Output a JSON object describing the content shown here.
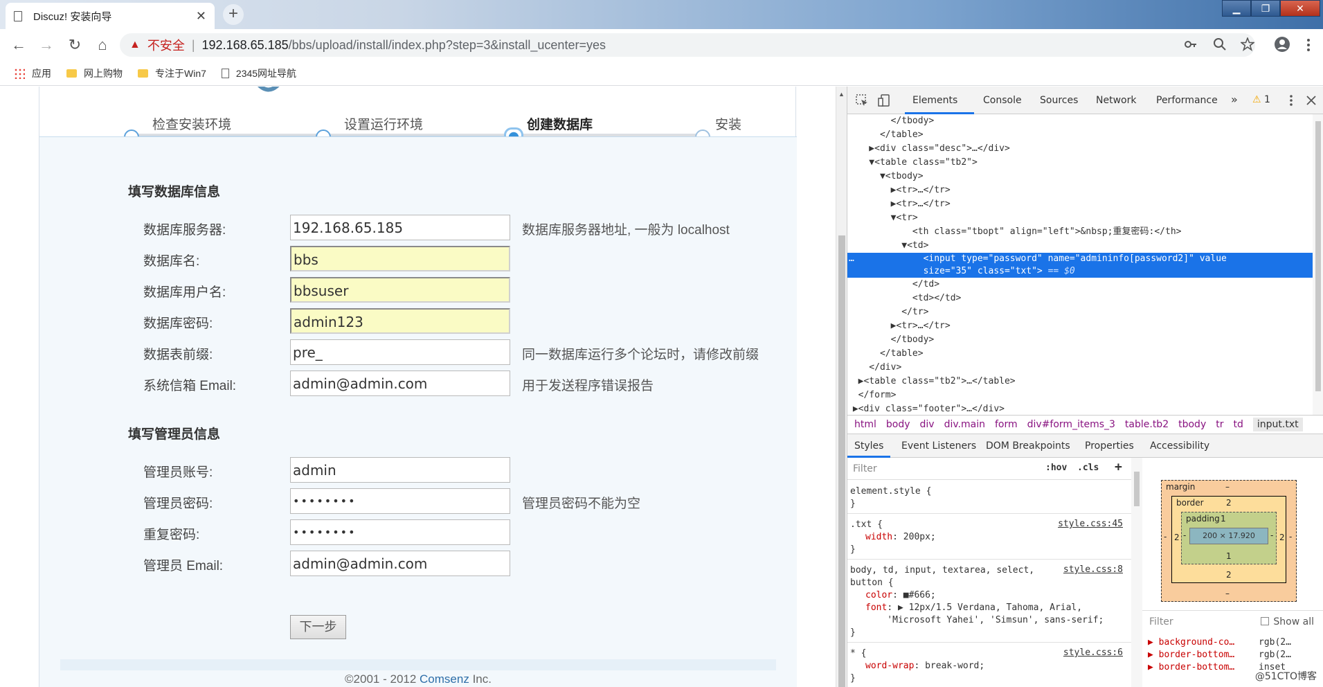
{
  "browser": {
    "tab_title": "Discuz! 安装向导",
    "tab_close": "✕",
    "new_tab": "+",
    "window_controls": [
      "▁",
      "❐",
      "✕"
    ],
    "nav": {
      "back": "←",
      "forward": "→",
      "reload": "↻",
      "home": "⌂"
    },
    "security_icon": "▲",
    "security_label": "不安全",
    "separator": "|",
    "url_host": "192.168.65.185",
    "url_path": "/bbs/upload/install/index.php?step=3&install_ucenter=yes",
    "omni_icons": [
      "key-icon",
      "zoom-icon",
      "star-icon",
      "profile-icon",
      "menu-icon"
    ],
    "bookmarks": [
      {
        "label": "应用",
        "icon": "apps-icon"
      },
      {
        "label": "网上购物",
        "icon": "folder-icon"
      },
      {
        "label": "专注于Win7",
        "icon": "folder-icon"
      },
      {
        "label": "2345网址导航",
        "icon": "page-icon"
      }
    ]
  },
  "installer": {
    "steps": [
      {
        "label": "检查安装环境",
        "state": "done"
      },
      {
        "label": "设置运行环境",
        "state": "done"
      },
      {
        "label": "创建数据库",
        "state": "active"
      },
      {
        "label": "安装",
        "state": "pending"
      }
    ],
    "db_section_title": "填写数据库信息",
    "db_fields": [
      {
        "label": "数据库服务器:",
        "value": "192.168.65.185",
        "hint": "数据库服务器地址, 一般为 localhost",
        "autofill": false
      },
      {
        "label": "数据库名:",
        "value": "bbs",
        "hint": "",
        "autofill": true
      },
      {
        "label": "数据库用户名:",
        "value": "bbsuser",
        "hint": "",
        "autofill": true
      },
      {
        "label": "数据库密码:",
        "value": "admin123",
        "hint": "",
        "autofill": true
      },
      {
        "label": "数据表前缀:",
        "value": "pre_",
        "hint": "同一数据库运行多个论坛时，请修改前缀",
        "autofill": false
      },
      {
        "label": "系统信箱 Email:",
        "value": "admin@admin.com",
        "hint": "用于发送程序错误报告",
        "autofill": false
      }
    ],
    "admin_section_title": "填写管理员信息",
    "admin_fields": [
      {
        "label": "管理员账号:",
        "value": "admin",
        "hint": ""
      },
      {
        "label": "管理员密码:",
        "value": "••••••••",
        "hint": "管理员密码不能为空"
      },
      {
        "label": "重复密码:",
        "value": "••••••••",
        "hint": ""
      },
      {
        "label": "管理员 Email:",
        "value": "admin@admin.com",
        "hint": ""
      }
    ],
    "next_button": "下一步",
    "copyright_prefix": "©2001 - 2012 ",
    "copyright_brand": "Comsenz",
    "copyright_suffix": " Inc."
  },
  "devtools": {
    "tabs": [
      "Elements",
      "Console",
      "Sources",
      "Network",
      "Performance"
    ],
    "more": "»",
    "warning_count": "1",
    "warning_icon": "⚠",
    "dom_lines": [
      "        </tbody>",
      "      </table>",
      "    ▶<div class=\"desc\">…</div>",
      "    ▼<table class=\"tb2\">",
      "      ▼<tbody>",
      "        ▶<tr>…</tr>",
      "        ▶<tr>…</tr>",
      "        ▼<tr>",
      "            <th class=\"tbopt\" align=\"left\">&nbsp;重复密码:</th>",
      "          ▼<td>",
      "",
      "            </td>",
      "            <td></td>",
      "          </tr>",
      "        ▶<tr>…</tr>",
      "        </tbody>",
      "      </table>",
      "    </div>",
      "  ▶<table class=\"tb2\">…</table>",
      "  </form>",
      " ▶<div class=\"footer\">…</div>"
    ],
    "selected_line_1": "              <input type=\"password\" name=\"admininfo[password2]\" value",
    "selected_line_2": "              size=\"35\" class=\"txt\">",
    "selected_eq": " == $0",
    "selected_dots": "…",
    "breadcrumbs": [
      "html",
      "body",
      "div",
      "div.main",
      "form",
      "div#form_items_3",
      "table.tb2",
      "tbody",
      "tr",
      "td",
      "input.txt"
    ],
    "sub_tabs": [
      "Styles",
      "Event Listeners",
      "DOM Breakpoints",
      "Properties",
      "Accessibility"
    ],
    "filter_placeholder": "Filter",
    "hov": ":hov",
    "cls": ".cls",
    "plus": "+",
    "style_rules": [
      {
        "selector": "element.style {",
        "props": [],
        "close": "}",
        "src": ""
      },
      {
        "selector": ".txt {",
        "props": [
          [
            "width",
            "200px;"
          ]
        ],
        "close": "}",
        "src": "style.css:45"
      },
      {
        "selector": "body, td, input, textarea, select,\nbutton {",
        "props": [
          [
            "color",
            "■#666;"
          ],
          [
            "font",
            "▶ 12px/1.5 Verdana, Tahoma, Arial,\n    'Microsoft Yahei', 'Simsun', sans-serif;"
          ]
        ],
        "close": "}",
        "src": "style.css:8"
      },
      {
        "selector": "* {",
        "props": [
          [
            "word-wrap",
            "break-word;"
          ]
        ],
        "close": "}",
        "src": "style.css:6"
      }
    ],
    "box_model": {
      "margin": "margin",
      "margin_val": "–",
      "border": "border",
      "border_val": "2",
      "padding": "padding",
      "padding_val": "1",
      "content": "200 × 17.920",
      "side_border": "2",
      "side_padding": "-",
      "side_margin": "-",
      "bottom_padding": "1",
      "bottom_border": "2",
      "bottom_margin": "–"
    },
    "computed_filter": "Filter",
    "show_all": "Show all",
    "computed": [
      [
        "▶ background-co…",
        "rgb(2…"
      ],
      [
        "▶ border-bottom…",
        "rgb(2…"
      ],
      [
        "▶ border-bottom…",
        "inset"
      ]
    ],
    "watermark": "@51CTO博客"
  }
}
